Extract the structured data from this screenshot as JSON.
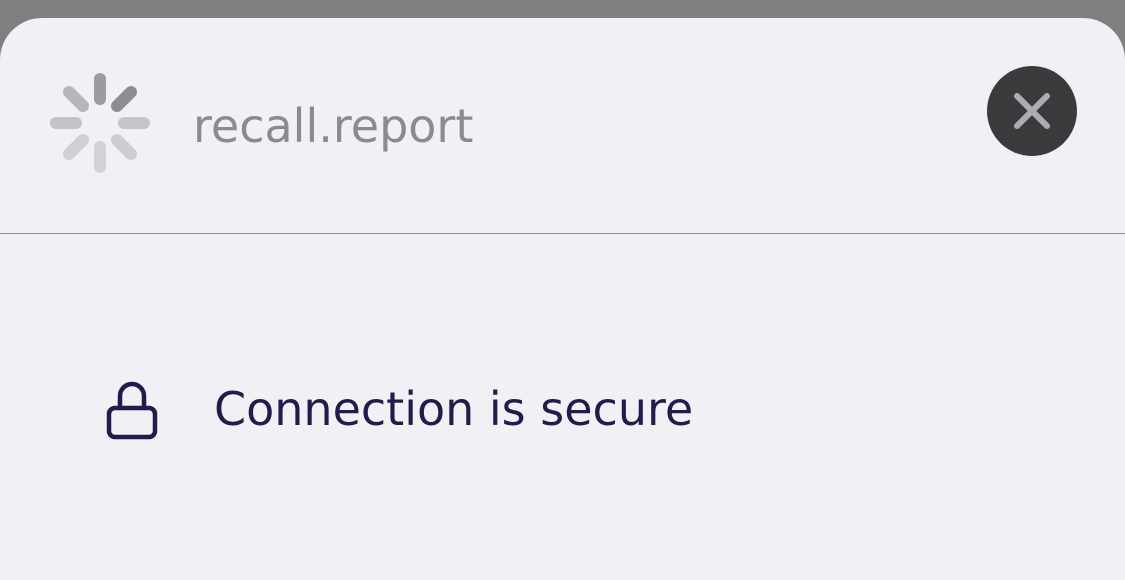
{
  "sheet": {
    "site_title": "recall.report",
    "loading_icon": "spinner-icon",
    "close_icon": "close-icon",
    "close_label": "Close"
  },
  "security": {
    "icon": "lock-icon",
    "label": "Connection is secure"
  },
  "colors": {
    "backdrop": "#7f7f7f",
    "sheet_background": "#f1f0f5",
    "title_text": "#8a8a8f",
    "primary_text": "#221c4a",
    "close_button_bg": "#3b3b3e",
    "close_glyph": "#aeaeb2",
    "divider": "#8d8d91"
  }
}
